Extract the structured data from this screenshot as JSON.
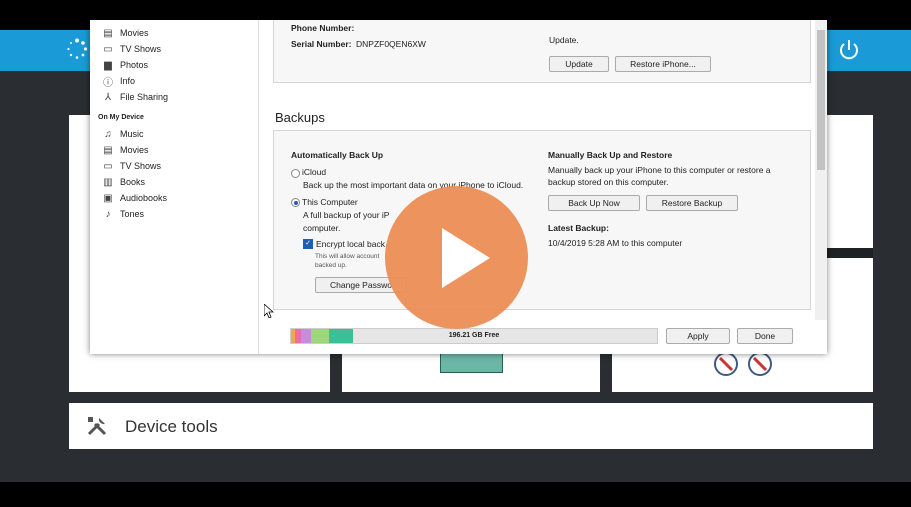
{
  "sidebar": {
    "top_items": [
      {
        "label": "Movies",
        "icon": "film-icon"
      },
      {
        "label": "TV Shows",
        "icon": "tv-icon"
      },
      {
        "label": "Photos",
        "icon": "camera-icon"
      },
      {
        "label": "Info",
        "icon": "info-icon"
      },
      {
        "label": "File Sharing",
        "icon": "file-sharing-icon"
      }
    ],
    "heading": "On My Device",
    "device_items": [
      {
        "label": "Music",
        "icon": "music-icon"
      },
      {
        "label": "Movies",
        "icon": "film-icon"
      },
      {
        "label": "TV Shows",
        "icon": "tv-icon"
      },
      {
        "label": "Books",
        "icon": "book-icon"
      },
      {
        "label": "Audiobooks",
        "icon": "audiobook-icon"
      },
      {
        "label": "Tones",
        "icon": "bell-icon"
      }
    ]
  },
  "summary": {
    "phone_label": "Phone Number:",
    "phone_value": "",
    "serial_label": "Serial Number:",
    "serial_value": "DNPZF0QEN6XW",
    "update_text": "Update.",
    "update_button": "Update",
    "restore_button": "Restore iPhone..."
  },
  "backups": {
    "title": "Backups",
    "auto_title": "Automatically Back Up",
    "icloud_label": "iCloud",
    "icloud_desc": "Back up the most important data on your iPhone to iCloud.",
    "computer_label": "This Computer",
    "computer_desc_1": "A full backup of your iP",
    "computer_desc_2": "computer.",
    "encrypt_label": "Encrypt local back",
    "encrypt_desc_1": "This will allow account",
    "encrypt_desc_2": "backed up.",
    "change_password_button": "Change Passwo",
    "manual_title": "Manually Back Up and Restore",
    "manual_desc_1": "Manually back up your iPhone to this computer or restore a",
    "manual_desc_2": "backup stored on this computer.",
    "backup_now_button": "Back Up Now",
    "restore_backup_button": "Restore Backup",
    "latest_title": "Latest Backup:",
    "latest_value": "10/4/2019 5:28 AM to this computer"
  },
  "footer": {
    "free_space": "196.21 GB Free",
    "apply_button": "Apply",
    "done_button": "Done"
  },
  "device_tools": {
    "label": "Device tools"
  },
  "colors": {
    "topbar": "#1a9bd7",
    "play_button": "#ec8e55",
    "stage": "#2a2d31"
  }
}
